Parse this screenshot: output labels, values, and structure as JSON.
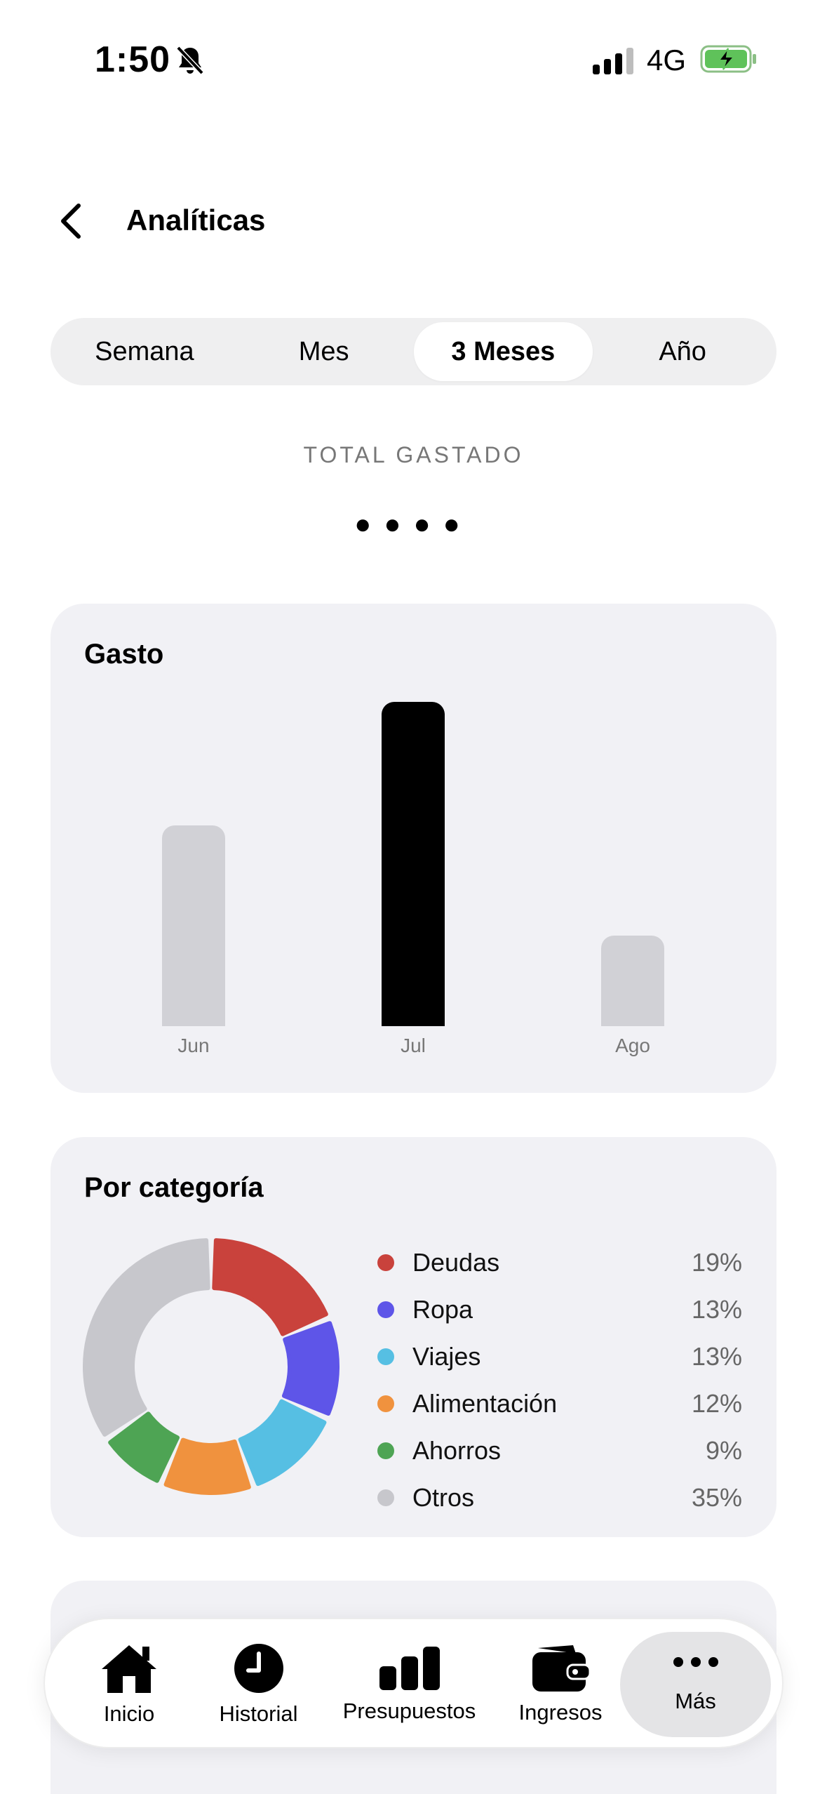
{
  "status": {
    "time": "1:50",
    "network": "4G"
  },
  "header": {
    "title": "Analíticas"
  },
  "segments": [
    "Semana",
    "Mes",
    "3 Meses",
    "Año"
  ],
  "active_segment": "3 Meses",
  "total": {
    "label": "TOTAL GASTADO",
    "value": "●●●●"
  },
  "gasto_card": {
    "title": "Gasto"
  },
  "chart_data": [
    {
      "type": "bar",
      "title": "Gasto",
      "categories": [
        "Jun",
        "Jul",
        "Ago"
      ],
      "values": [
        62,
        100,
        28
      ],
      "highlight": "Jul",
      "colors": {
        "default": "#d1d1d6",
        "highlight": "#000000"
      }
    },
    {
      "type": "pie",
      "title": "Por categoría",
      "categories": [
        "Deudas",
        "Ropa",
        "Viajes",
        "Alimentación",
        "Ahorros",
        "Otros"
      ],
      "values": [
        19,
        13,
        13,
        12,
        9,
        35
      ],
      "labels": [
        "19%",
        "13%",
        "13%",
        "12%",
        "9%",
        "35%"
      ],
      "colors": [
        "#c9423c",
        "#5e55e8",
        "#56bfe3",
        "#f0923e",
        "#4ea454",
        "#c7c7cc"
      ]
    }
  ],
  "category_card": {
    "title": "Por categoría"
  },
  "tabbar": {
    "items": [
      {
        "label": "Inicio",
        "icon": "house-icon"
      },
      {
        "label": "Historial",
        "icon": "clock-icon"
      },
      {
        "label": "Presupuestos",
        "icon": "bar-chart-icon"
      },
      {
        "label": "Ingresos",
        "icon": "wallet-icon"
      },
      {
        "label": "Más",
        "icon": "ellipsis-icon"
      }
    ],
    "active": "Más"
  }
}
